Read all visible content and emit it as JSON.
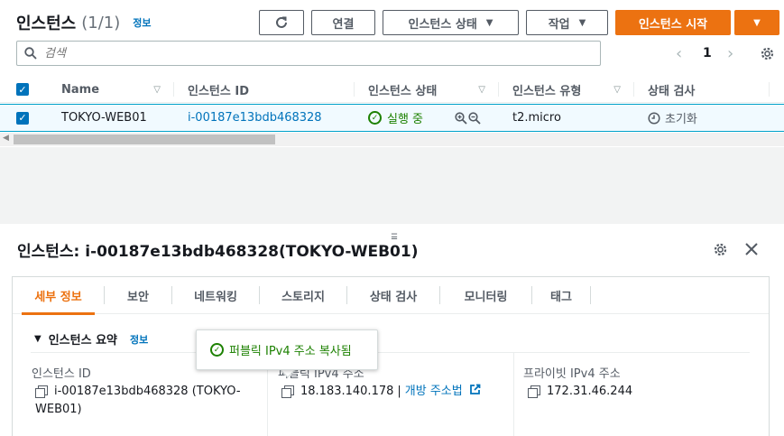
{
  "header": {
    "title": "인스턴스",
    "count": "(1/1)",
    "info_link": "정보",
    "buttons": {
      "refresh_icon": "refresh-icon",
      "connect": "연결",
      "instance_state": "인스턴스 상태",
      "actions": "작업",
      "launch": "인스턴스 시작"
    }
  },
  "search": {
    "placeholder": "검색"
  },
  "pagination": {
    "current": "1"
  },
  "table": {
    "columns": [
      "Name",
      "인스턴스 ID",
      "인스턴스 상태",
      "인스턴스 유형",
      "상태 검사"
    ],
    "rows": [
      {
        "name": "TOKYO-WEB01",
        "instance_id": "i-00187e13bdb468328",
        "state": "실행 중",
        "type": "t2.micro",
        "status_check": "초기화"
      }
    ]
  },
  "detail": {
    "title_prefix": "인스턴스:",
    "title": "i-00187e13bdb468328(TOKYO-WEB01)",
    "tabs": [
      "세부 정보",
      "보안",
      "네트워킹",
      "스토리지",
      "상태 검사",
      "모니터링",
      "태그"
    ],
    "active_tab": "세부 정보",
    "summary": {
      "heading": "인스턴스 요약",
      "info_link": "정보",
      "fields": {
        "instance_id_label": "인스턴스 ID",
        "instance_id_value_line1": "i-00187e13bdb468328 (TOKYO-",
        "instance_id_value_line2": "WEB01)",
        "public_ip_label": "퍼블릭 IPv4 주소",
        "public_ip_value": "18.183.140.178",
        "public_ip_sep": "|",
        "public_ip_link": "개방 주소법",
        "private_ip_label": "프라이빗 IPv4 주소",
        "private_ip_value": "172.31.46.244"
      }
    },
    "toast": "퍼블릭 IPv4 주소 복사됨"
  },
  "colors": {
    "accent": "#ec7211",
    "link": "#0073bb",
    "success": "#1d8102",
    "selected_row": "#f1faff"
  }
}
